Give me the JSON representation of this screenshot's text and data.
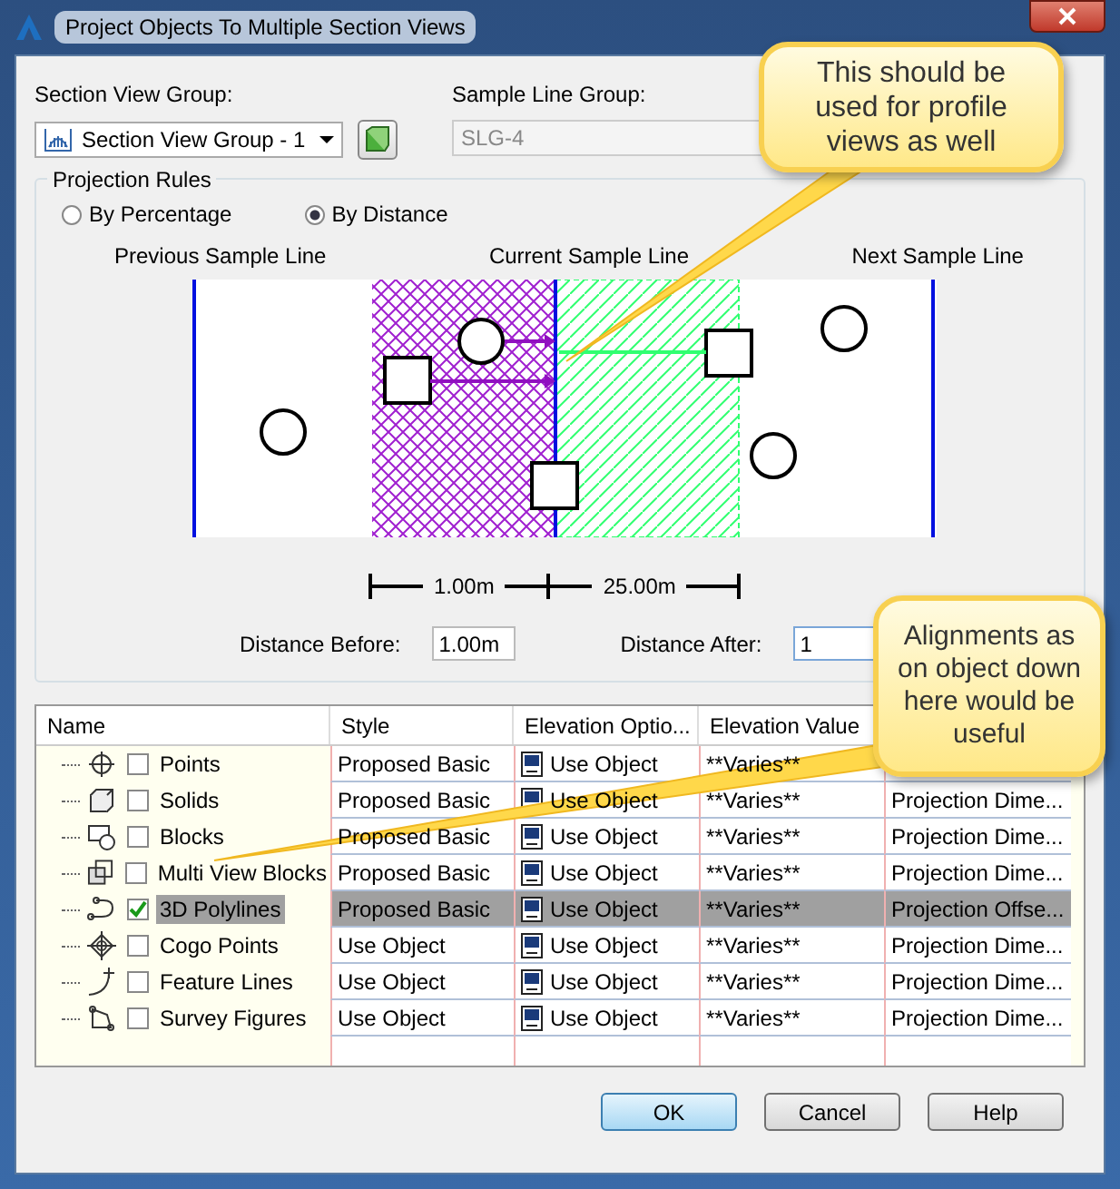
{
  "window": {
    "title": "Project Objects To Multiple Section Views"
  },
  "section_view_group": {
    "label": "Section View Group:",
    "value": "Section View Group - 1"
  },
  "sample_line_group": {
    "label": "Sample Line Group:",
    "value": "SLG-4",
    "disabled": true
  },
  "projection_rules": {
    "title": "Projection Rules",
    "options": [
      {
        "label": "By Percentage",
        "selected": false
      },
      {
        "label": "By Distance",
        "selected": true
      }
    ],
    "diagram_labels": [
      "Previous Sample Line",
      "Current Sample Line",
      "Next Sample Line"
    ],
    "dimension_before": "1.00m",
    "dimension_after": "25.00m",
    "distance_before": {
      "label": "Distance Before:",
      "value": "1.00m"
    },
    "distance_after": {
      "label": "Distance After:",
      "value": "1"
    }
  },
  "table": {
    "columns": [
      "Name",
      "Style",
      "Elevation Optio...",
      "Elevation Value"
    ],
    "rows": [
      {
        "kind": "points",
        "name": "Points",
        "checked": false,
        "selected": false,
        "style": "Proposed Basic",
        "elevation_option": "Use Object",
        "elevation_value": "**Varies**"
      },
      {
        "kind": "solids",
        "name": "Solids",
        "checked": false,
        "selected": false,
        "style": "Proposed Basic",
        "elevation_option": "Use Object",
        "elevation_value": "**Varies**",
        "column_5": "Projection Dime..."
      },
      {
        "kind": "blocks",
        "name": "Blocks",
        "checked": false,
        "selected": false,
        "style": "Proposed Basic",
        "elevation_option": "Use Object",
        "elevation_value": "**Varies**",
        "column_5": "Projection Dime..."
      },
      {
        "kind": "multiview",
        "name": "Multi View Blocks",
        "checked": false,
        "selected": false,
        "style": "Proposed Basic",
        "elevation_option": "Use Object",
        "elevation_value": "**Varies**",
        "column_5": "Projection Dime..."
      },
      {
        "kind": "polyline",
        "name": "3D Polylines",
        "checked": true,
        "selected": true,
        "style": "Proposed Basic",
        "elevation_option": "Use Object",
        "elevation_value": "**Varies**",
        "column_5": "Projection Offse..."
      },
      {
        "kind": "cogo",
        "name": "Cogo Points",
        "checked": false,
        "selected": false,
        "style": "Use Object",
        "elevation_option": "Use Object",
        "elevation_value": "**Varies**",
        "column_5": "Projection Dime..."
      },
      {
        "kind": "feature",
        "name": "Feature Lines",
        "checked": false,
        "selected": false,
        "style": "Use Object",
        "elevation_option": "Use Object",
        "elevation_value": "**Varies**",
        "column_5": "Projection Dime..."
      },
      {
        "kind": "survey",
        "name": "Survey Figures",
        "checked": false,
        "selected": false,
        "style": "Use Object",
        "elevation_option": "Use Object",
        "elevation_value": "**Varies**",
        "column_5": "Projection Dime..."
      }
    ]
  },
  "buttons": [
    {
      "label": "OK",
      "default": true
    },
    {
      "label": "Cancel",
      "default": false
    },
    {
      "label": "Help",
      "default": false
    }
  ],
  "callouts": [
    {
      "text": "This should be used for profile views as well"
    },
    {
      "text": "Alignments as on object down here would be useful"
    }
  ]
}
